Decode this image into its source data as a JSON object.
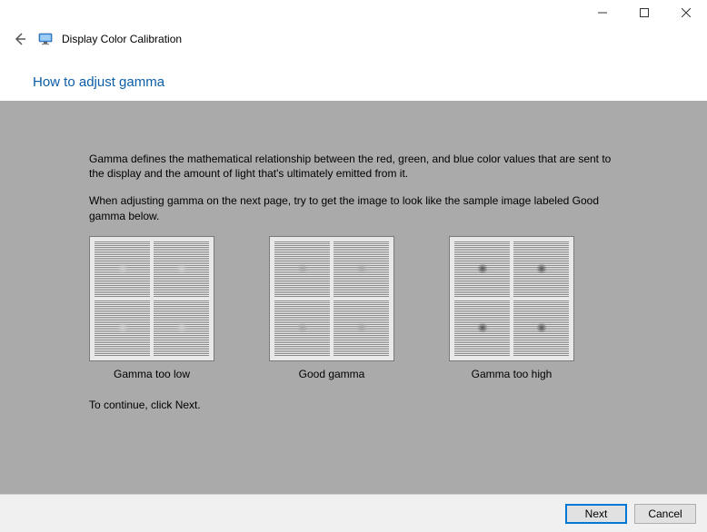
{
  "window": {
    "title": "Display Color Calibration"
  },
  "heading": "How to adjust gamma",
  "body": {
    "p1": "Gamma defines the mathematical relationship between the red, green, and blue color values that are sent to the display and the amount of light that's ultimately emitted from it.",
    "p2": "When adjusting gamma on the next page, try to get the image to look like the sample image labeled Good gamma below.",
    "continue": "To continue, click Next."
  },
  "samples": {
    "low": "Gamma too low",
    "good": "Good gamma",
    "high": "Gamma too high"
  },
  "buttons": {
    "next": "Next",
    "cancel": "Cancel"
  }
}
